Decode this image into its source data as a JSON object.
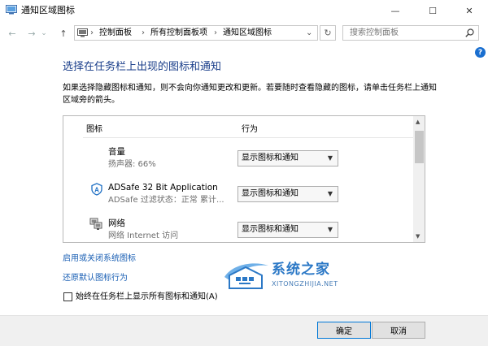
{
  "window": {
    "title": "通知区域图标",
    "controls": {
      "minimize": "—",
      "maximize": "☐",
      "close": "✕"
    }
  },
  "nav": {
    "back": "←",
    "forward": "→",
    "up": "↑",
    "dropdown": "⌄",
    "refresh": "↻"
  },
  "address": {
    "crumbs": [
      "控制面板",
      "所有控制面板项",
      "通知区域图标"
    ],
    "separator": "›",
    "dropdown": "⌄"
  },
  "search": {
    "placeholder": "搜索控制面板"
  },
  "help": "?",
  "page": {
    "heading": "选择在任务栏上出现的图标和通知",
    "description": "如果选择隐藏图标和通知，则不会向你通知更改和更新。若要随时查看隐藏的图标，请单击任务栏上通知区域旁的箭头。"
  },
  "table": {
    "col_icon": "图标",
    "col_behavior": "行为",
    "rows": [
      {
        "name": "音量",
        "sub": "扬声器: 66%",
        "behavior": "显示图标和通知",
        "icon": "speaker-icon"
      },
      {
        "name": "ADSafe 32 Bit Application",
        "sub": "ADSafe 过滤状态：正常 累计...",
        "behavior": "显示图标和通知",
        "icon": "shield-a-icon"
      },
      {
        "name": "网络",
        "sub": "网络 Internet 访问",
        "behavior": "显示图标和通知",
        "icon": "network-icon"
      }
    ]
  },
  "links": {
    "system_icons": "启用或关闭系统图标",
    "restore": "还原默认图标行为"
  },
  "checkbox": {
    "label": "始终在任务栏上显示所有图标和通知(A)",
    "checked": false
  },
  "watermark": {
    "name": "系统之家",
    "url": "XITONGZHIJIA.NET"
  },
  "buttons": {
    "ok": "确定",
    "cancel": "取消"
  },
  "colors": {
    "heading": "#1a3e8a",
    "link": "#1a5fb4",
    "watermark": "#2b78c6",
    "accent": "#0078d7"
  }
}
